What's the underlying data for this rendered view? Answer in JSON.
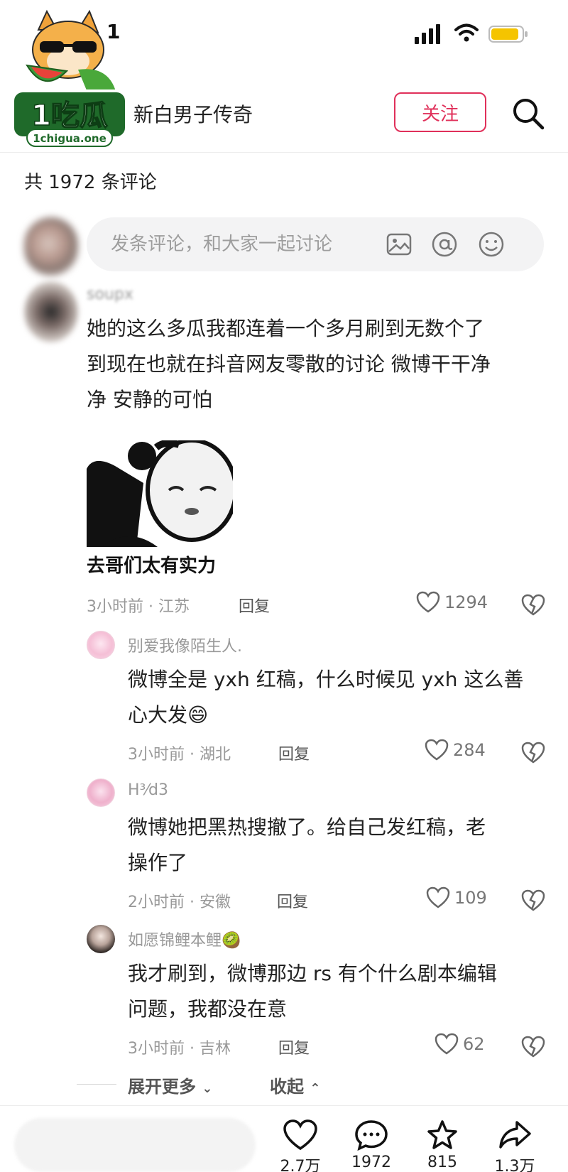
{
  "status_bar": {
    "time_fragment": "1",
    "battery_color": "#f5c400"
  },
  "watermark": {
    "text": "1吃瓜",
    "url_text": "1chigua.one"
  },
  "header": {
    "author": "新白男子传奇",
    "follow_label": "关注",
    "accent": "#e0305a"
  },
  "comment_count": "共 1972 条评论",
  "composer": {
    "placeholder": "发条评论，和大家一起讨论",
    "icons": [
      "image-icon",
      "at-icon",
      "emoji-icon"
    ]
  },
  "comments": [
    {
      "user": "soupx",
      "lines": [
        "她的这么多瓜我都连着一个多月刷到无数个了",
        "到现在也就在抖音网友零散的讨论  微博干干净",
        "净  安静的可怕"
      ],
      "sticker_caption": "去哥们太有实力",
      "time_loc": "3小时前 · 江苏",
      "reply": "回复",
      "likes": "1294"
    },
    {
      "user": "别爱我像陌生人.",
      "lines": [
        "微博全是 yxh 红稿，什么时候见 yxh 这么善",
        "心大发😄"
      ],
      "time_loc": "3小时前 · 湖北",
      "reply": "回复",
      "likes": "284"
    },
    {
      "user": "H³⁄d3",
      "lines": [
        "微博她把黑热搜撤了。给自己发红稿，老",
        "操作了"
      ],
      "time_loc": "2小时前 · 安徽",
      "reply": "回复",
      "likes": "109"
    },
    {
      "user": "如愿锦鲤本鲤🥝",
      "lines": [
        "我才刷到，微博那边 rs 有个什么剧本编辑",
        "问题，我都没在意"
      ],
      "time_loc": "3小时前 · 吉林",
      "reply": "回复",
      "likes": "62"
    }
  ],
  "expand_more": "展开更多",
  "collapse": "收起",
  "bottom_bar": {
    "like_count": "2.7万",
    "comment_count": "1972",
    "favorite_count": "815",
    "share_count": "1.3万"
  }
}
